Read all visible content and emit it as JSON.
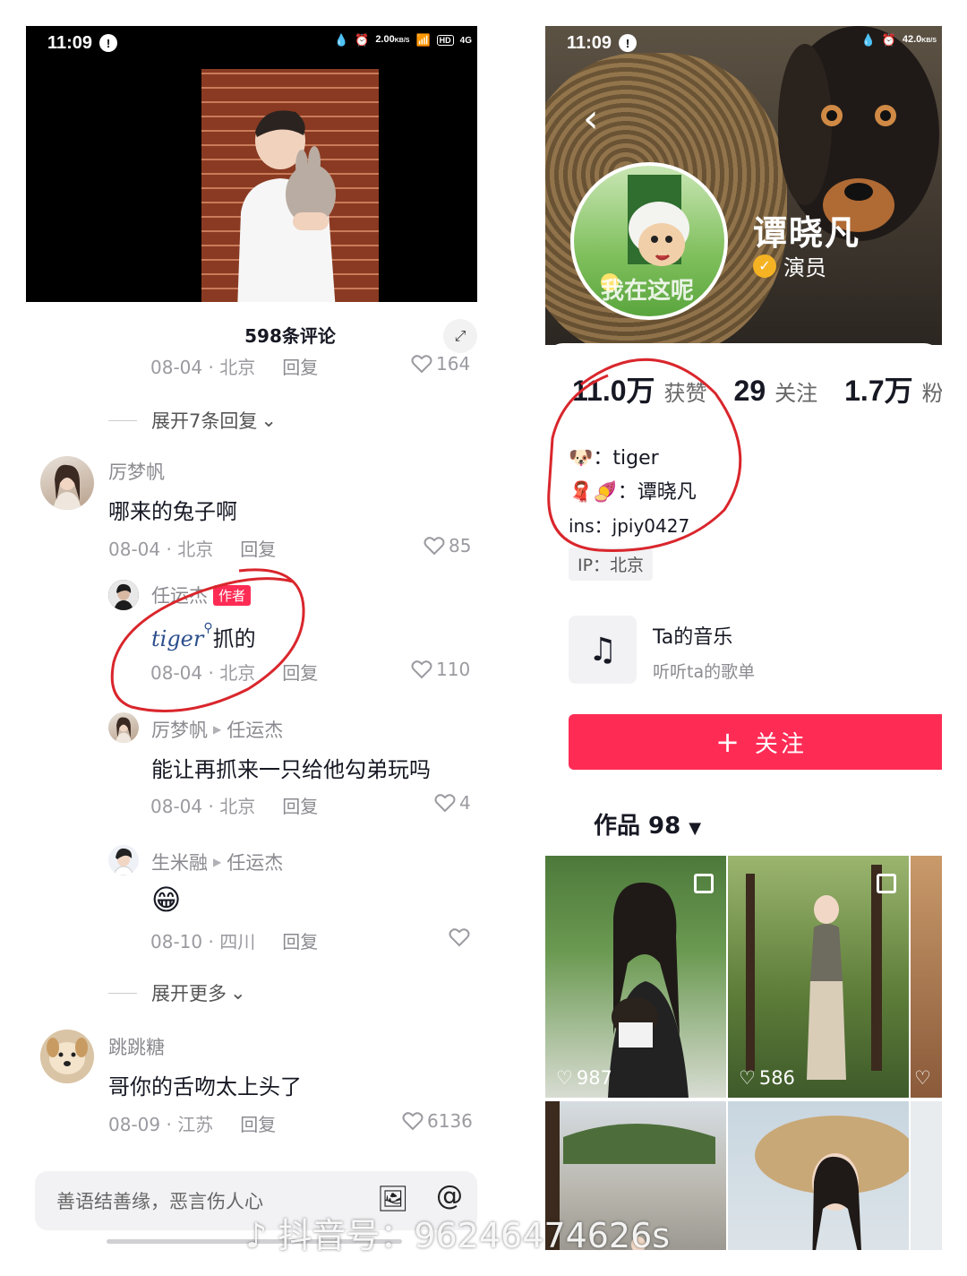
{
  "left": {
    "status": {
      "time": "11:09",
      "speed": "2.00",
      "speed_unit": "KB/S",
      "hd": "HD",
      "network": "4G"
    },
    "comments_title": "598条评论",
    "top_comment": {
      "date": "08-04",
      "location": "北京",
      "reply_label": "回复",
      "likes": "164"
    },
    "expand_replies": "展开7条回复",
    "comments": [
      {
        "username": "厉梦帆",
        "text": "哪来的兔子啊",
        "date": "08-04",
        "location": "北京",
        "reply_label": "回复",
        "likes": "85"
      },
      {
        "username": "任运杰",
        "badge": "作者",
        "text_link": "tiger",
        "text": "抓的",
        "date": "08-04",
        "location": "北京",
        "reply_label": "回复",
        "likes": "110"
      },
      {
        "username": "厉梦帆",
        "reply_to": "任运杰",
        "text": "能让再抓来一只给他勾弟玩吗",
        "date": "08-04",
        "location": "北京",
        "reply_label": "回复",
        "likes": "4"
      },
      {
        "username": "生米融",
        "reply_to": "任运杰",
        "text": "😁",
        "date": "08-10",
        "location": "四川",
        "reply_label": "回复",
        "likes": ""
      },
      {
        "username": "跳跳糖",
        "text": "哥你的舌吻太上头了",
        "date": "08-09",
        "location": "江苏",
        "reply_label": "回复",
        "likes": "6136"
      }
    ],
    "expand_more": "展开更多",
    "input_placeholder": "善语结善缘，恶言伤人心"
  },
  "right": {
    "status": {
      "time": "11:09",
      "speed": "42.0",
      "speed_unit": "KB/S"
    },
    "profile": {
      "name": "谭晓凡",
      "verified_label": "演员",
      "avatar_overlay": "我在这呢"
    },
    "stats": [
      {
        "num": "11.0万",
        "label": "获赞"
      },
      {
        "num": "29",
        "label": "关注"
      },
      {
        "num": "1.7万",
        "label": "粉"
      }
    ],
    "bio": [
      {
        "emoji": "🐶",
        "text": "：tiger"
      },
      {
        "emoji": "🧣🍠",
        "text": "：谭晓凡"
      },
      {
        "emoji": "",
        "text": "ins：jpiy0427"
      }
    ],
    "ip_label": "IP：北京",
    "music": {
      "title": "Ta的音乐",
      "subtitle": "听听ta的歌单"
    },
    "follow_button": "关注",
    "works_tab": "作品 98",
    "works": [
      {
        "likes": "987"
      },
      {
        "likes": "586"
      }
    ]
  },
  "watermark": "抖音号：96246474626s",
  "colors": {
    "accent": "#fe2c55",
    "annotation": "#d9262c",
    "verified": "#f5b324"
  }
}
